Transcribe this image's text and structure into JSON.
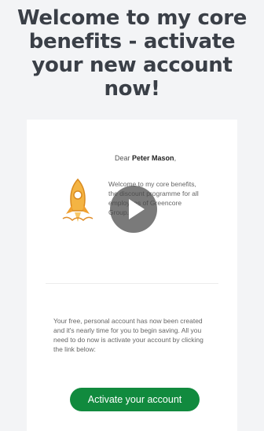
{
  "headline": "Welcome to my core benefits - activate your new account now!",
  "email": {
    "greeting_prefix": "Dear",
    "recipient_name": "Peter Mason",
    "greeting_suffix": ",",
    "intro_text": "Welcome to my core benefits, the discount programme for all employees of Greencore Group.",
    "body_text": "Your free, personal account has now been created and it's nearly time for you to begin saving. All you need to do now is activate your account by clicking the link below:",
    "activate_button_label": "Activate your account"
  },
  "icons": {
    "rocket": "rocket-icon",
    "play": "play-icon"
  },
  "colors": {
    "button_green": "#118a3e",
    "rocket_orange": "#f0a030",
    "headline": "#3a3f47"
  }
}
